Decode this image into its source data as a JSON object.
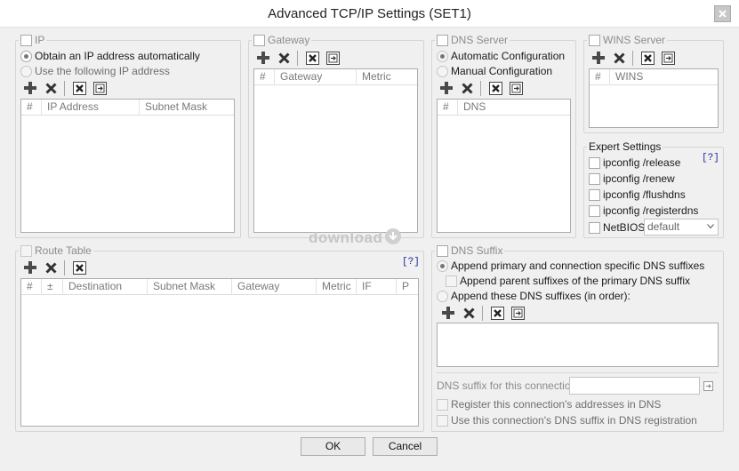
{
  "window": {
    "title": "Advanced TCP/IP Settings (SET1)"
  },
  "ip": {
    "label": "IP",
    "auto_label": "Obtain an IP address automatically",
    "manual_label": "Use the following IP address",
    "columns": [
      "#",
      "IP Address",
      "Subnet Mask"
    ]
  },
  "gateway": {
    "label": "Gateway",
    "columns": [
      "#",
      "Gateway",
      "Metric"
    ]
  },
  "dns_server": {
    "label": "DNS Server",
    "auto_label": "Automatic Configuration",
    "manual_label": "Manual Configuration",
    "columns": [
      "#",
      "DNS"
    ]
  },
  "wins": {
    "label": "WINS Server",
    "columns": [
      "#",
      "WINS"
    ]
  },
  "expert": {
    "label": "Expert Settings",
    "help": "[?]",
    "items": [
      "ipconfig /release",
      "ipconfig /renew",
      "ipconfig /flushdns",
      "ipconfig /registerdns"
    ],
    "netbios_label": "NetBIOS",
    "netbios_value": "default"
  },
  "route": {
    "label": "Route Table",
    "help": "[?]",
    "columns": [
      "#",
      "±",
      "Destination",
      "Subnet Mask",
      "Gateway",
      "Metric",
      "IF",
      "P"
    ]
  },
  "dns_suffix": {
    "label": "DNS Suffix",
    "append_primary_label": "Append primary and connection specific DNS suffixes",
    "append_parent_label": "Append parent suffixes of the primary DNS suffix",
    "append_these_label": "Append these DNS suffixes (in order):",
    "connection_suffix_label": "DNS suffix for this connection:",
    "connection_suffix_value": "",
    "register_label": "Register this connection's addresses in DNS",
    "use_suffix_label": "Use this connection's DNS suffix in DNS registration"
  },
  "watermark": "download",
  "buttons": {
    "ok": "OK",
    "cancel": "Cancel"
  },
  "icons": [
    "add-icon",
    "delete-icon",
    "clear-icon",
    "import-icon",
    "close-icon",
    "dropdown-arrow-icon",
    "browse-icon"
  ]
}
